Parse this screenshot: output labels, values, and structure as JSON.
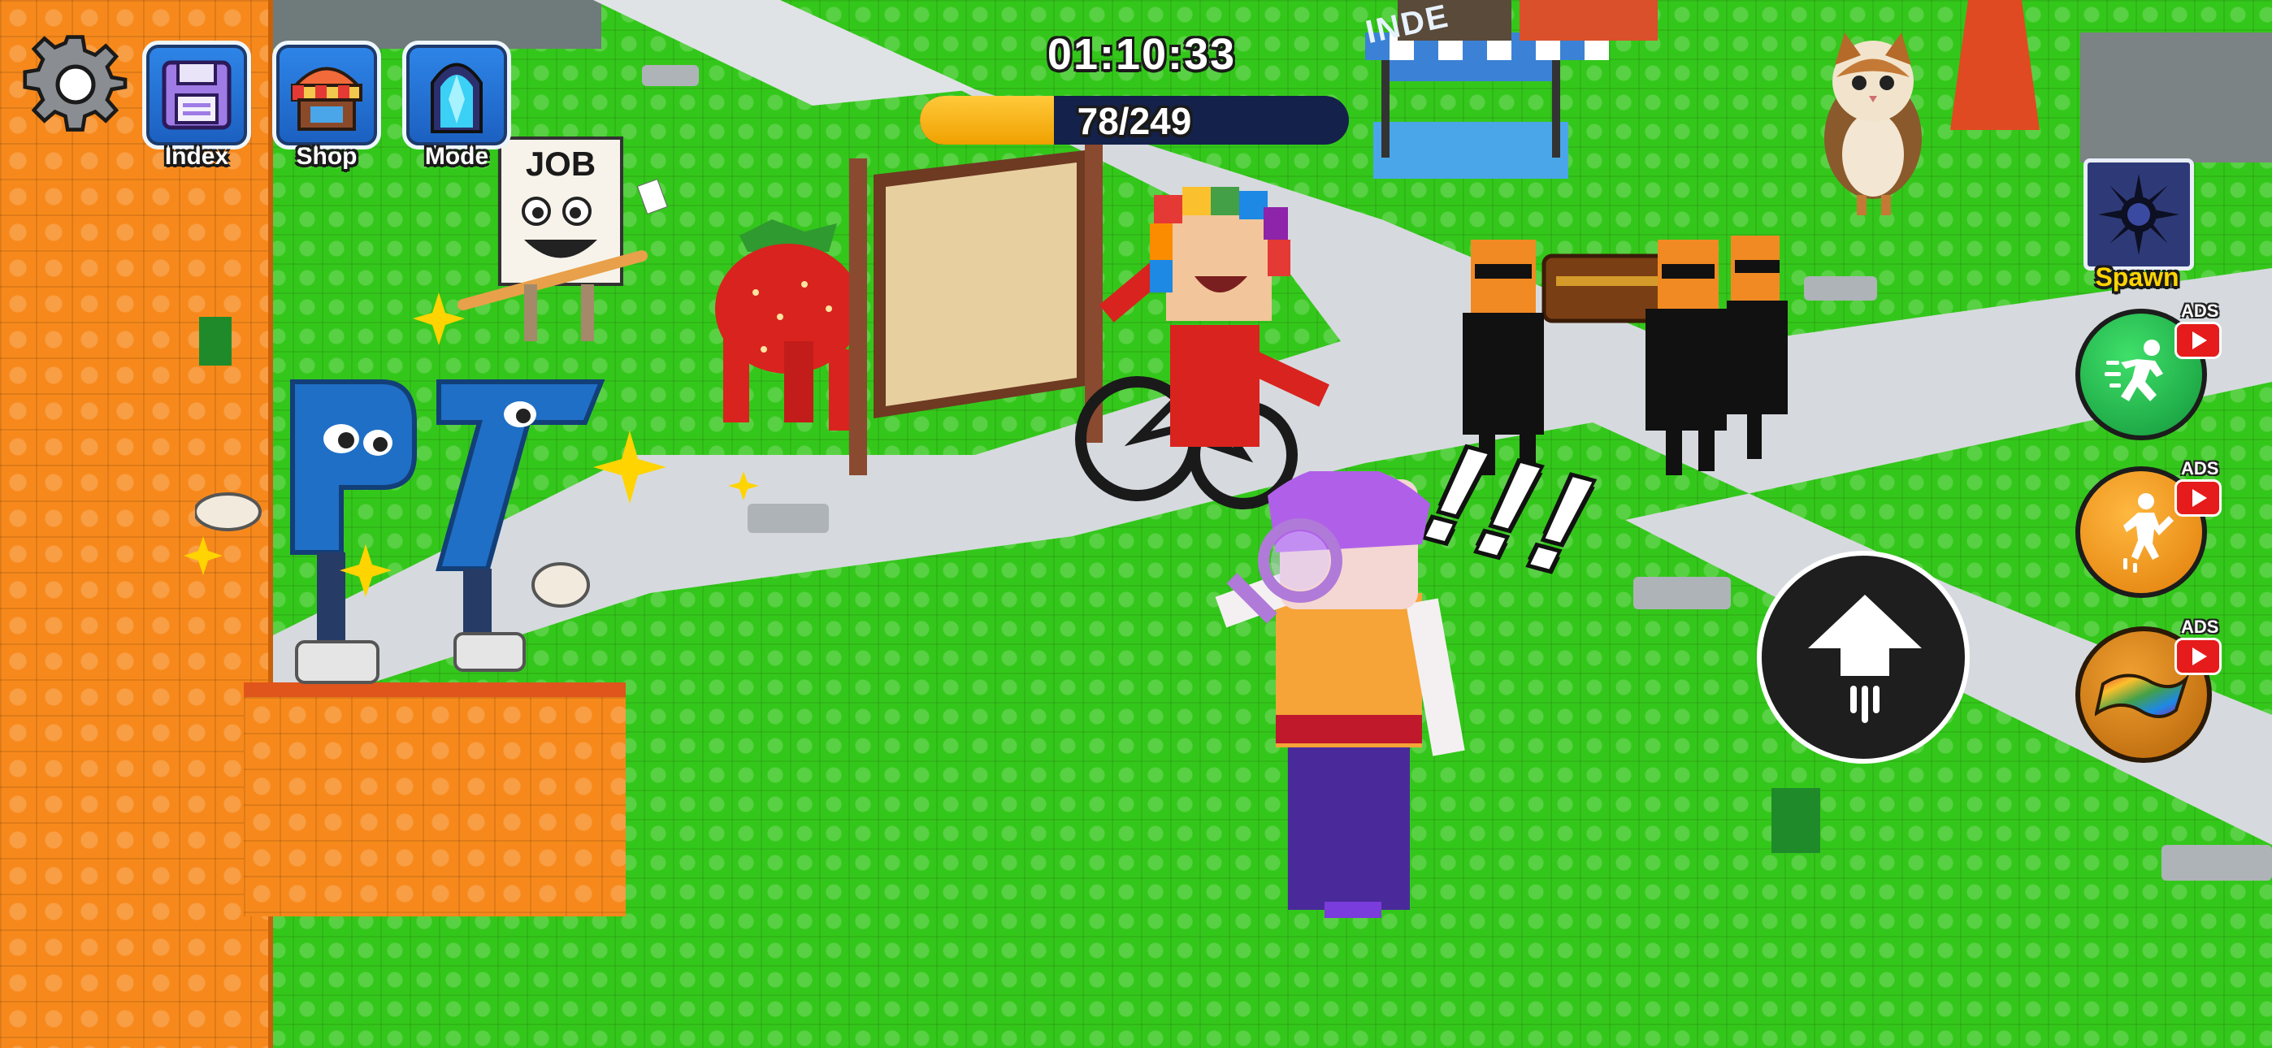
{
  "hud": {
    "timer": "01:10:33",
    "progress": {
      "text": "78/249",
      "collected": 78,
      "total": 249,
      "fill_color": "#f6b40e",
      "track_color": "#14214a"
    }
  },
  "top_buttons": [
    {
      "label": "Index",
      "icon": "floppy-disk-icon"
    },
    {
      "label": "Shop",
      "icon": "shop-stall-icon"
    },
    {
      "label": "Mode",
      "icon": "crystal-portal-icon"
    }
  ],
  "settings": {
    "icon": "gear-icon"
  },
  "right_panel": {
    "spawn_label": "Spawn",
    "ads_label": "ADS",
    "buttons": [
      {
        "icon": "running-figure-icon",
        "color": "#1fb84a"
      },
      {
        "icon": "jumping-figure-icon",
        "color": "#f59a14"
      },
      {
        "icon": "magic-carpet-icon",
        "color": "#d37a10"
      }
    ],
    "jump": {
      "icon": "up-arrow-icon"
    }
  },
  "world": {
    "job_sign": "JOB",
    "store_sign": "INDE",
    "exclamation": "!!!"
  },
  "colors": {
    "grass": "#34c71b",
    "path": "#d9dde3",
    "orange_pillar": "#f7891c",
    "accent_yellow": "#ffd400"
  }
}
